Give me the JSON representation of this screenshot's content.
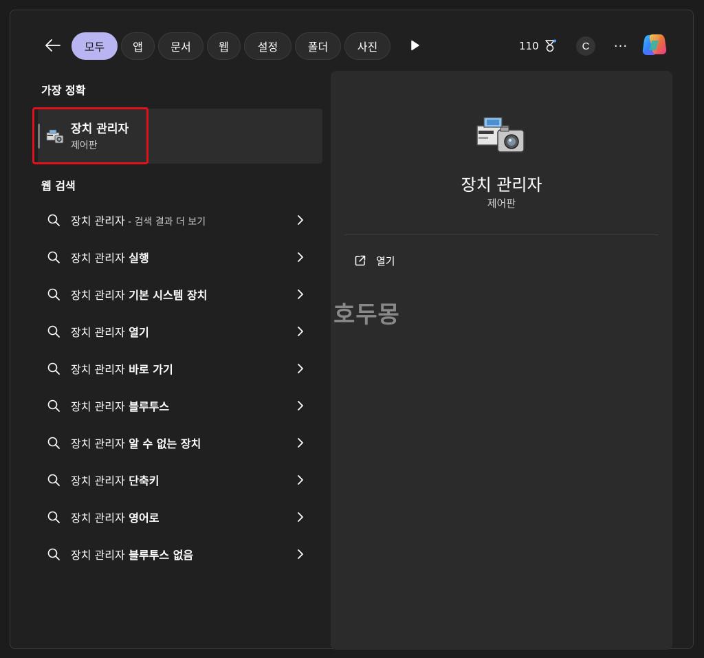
{
  "topbar": {
    "filters": [
      {
        "label": "모두",
        "active": true
      },
      {
        "label": "앱"
      },
      {
        "label": "문서"
      },
      {
        "label": "웹"
      },
      {
        "label": "설정"
      },
      {
        "label": "폴더"
      },
      {
        "label": "사진"
      }
    ],
    "points": "110",
    "avatar_initial": "C",
    "more_label": "···"
  },
  "best_match": {
    "section_title": "가장 정확",
    "title": "장치 관리자",
    "subtitle": "제어판"
  },
  "web_search": {
    "section_title": "웹 검색",
    "items": [
      {
        "query": "장치 관리자",
        "suffix": " - 검색 결과 더 보기",
        "suffix_dim": true
      },
      {
        "query": "장치 관리자",
        "suffix": " 실행"
      },
      {
        "query": "장치 관리자",
        "suffix": " 기본 시스템 장치"
      },
      {
        "query": "장치 관리자",
        "suffix": " 열기"
      },
      {
        "query": "장치 관리자",
        "suffix": " 바로 가기"
      },
      {
        "query": "장치 관리자",
        "suffix": " 블루투스"
      },
      {
        "query": "장치 관리자",
        "suffix": " 알 수 없는 장치"
      },
      {
        "query": "장치 관리자",
        "suffix": " 단축키"
      },
      {
        "query": "장치 관리자",
        "suffix": " 영어로"
      },
      {
        "query": "장치 관리자",
        "suffix": " 블루투스 없음"
      }
    ]
  },
  "detail": {
    "title": "장치 관리자",
    "subtitle": "제어판",
    "open_label": "열기"
  },
  "watermark": "호두몽",
  "colors": {
    "active_pill": "#b9b5f2",
    "highlight_box": "#e0131c",
    "window_bg": "#202020",
    "panel_bg": "#2b2b2b"
  }
}
